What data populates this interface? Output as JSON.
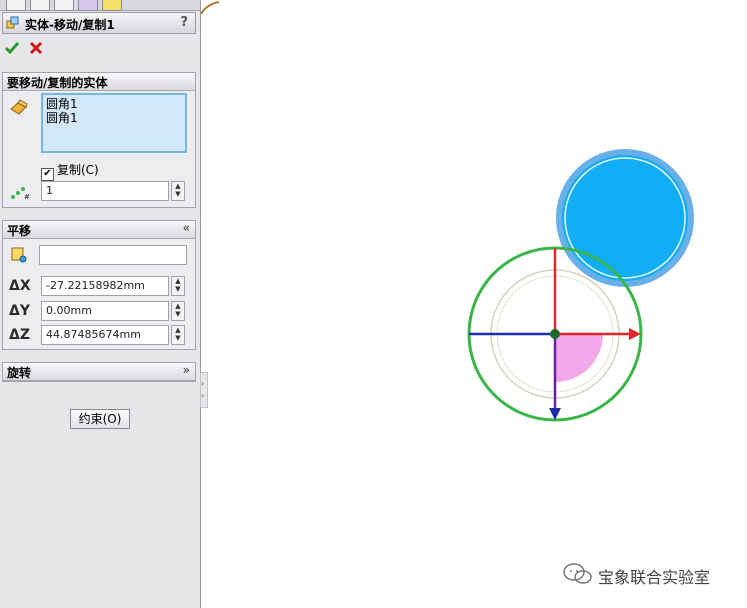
{
  "panel": {
    "title": "实体-移动/复制1",
    "help": "?",
    "ok_icon": "green-check-icon",
    "cancel_icon": "red-x-icon"
  },
  "bodies_group": {
    "header": "要移动/复制的实体",
    "items": [
      "圆角1",
      "圆角1"
    ],
    "copy_label": "复制(C)",
    "copy_checked": true,
    "copies_value": "1"
  },
  "translate_group": {
    "header": "平移",
    "reference_value": "",
    "dx_label": "ΔX",
    "dx_value": "-27.22158982mm",
    "dy_label": "ΔY",
    "dy_value": "0.00mm",
    "dz_label": "ΔZ",
    "dz_value": "44.87485674mm"
  },
  "rotate_group": {
    "header": "旋转"
  },
  "constraints_button": "约束(O)",
  "watermark": {
    "text": "宝象联合实验室",
    "icon": "wechat-icon"
  },
  "colors": {
    "accent_blue": "#11aef5",
    "triad_green": "#3ab54a",
    "axis_red": "#e0262b",
    "axis_blue": "#1d2fa8",
    "rotation_pink": "#f0a8e8",
    "selection_bg": "#d3e8fb"
  }
}
